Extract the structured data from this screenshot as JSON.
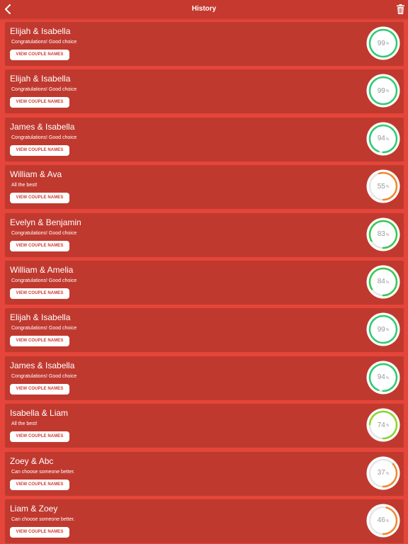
{
  "header": {
    "title": "History"
  },
  "button_label": "VIEW COUPLE NAMES",
  "unit": "%",
  "colors": {
    "background": "#e5453a",
    "card": "#c0392f",
    "high": "#2ecc71",
    "good": "#37c94e",
    "medium": "#8bd62d",
    "low": "#ed8a2d",
    "track": "#e6e6e6"
  },
  "items": [
    {
      "names": "Elijah & Isabella",
      "message": "Congratulations! Good choice",
      "percent": 99,
      "color": "#2ecc71"
    },
    {
      "names": "Elijah & Isabella",
      "message": "Congratulations! Good choice",
      "percent": 99,
      "color": "#2ecc71"
    },
    {
      "names": "James & Isabella",
      "message": "Congratulations! Good choice",
      "percent": 94,
      "color": "#2ecc71"
    },
    {
      "names": "William & Ava",
      "message": "All the best!",
      "percent": 55,
      "color": "#ed8a2d"
    },
    {
      "names": "Evelyn & Benjamin",
      "message": "Congratulations! Good choice",
      "percent": 83,
      "color": "#37c94e"
    },
    {
      "names": "William & Amelia",
      "message": "Congratulations! Good choice",
      "percent": 84,
      "color": "#37c94e"
    },
    {
      "names": "Elijah & Isabella",
      "message": "Congratulations! Good choice",
      "percent": 99,
      "color": "#2ecc71"
    },
    {
      "names": "James & Isabella",
      "message": "Congratulations! Good choice",
      "percent": 94,
      "color": "#2ecc71"
    },
    {
      "names": "Isabella & Liam",
      "message": "All the best!",
      "percent": 74,
      "color": "#8bd62d"
    },
    {
      "names": "Zoey & Abc",
      "message": "Can choose someone better.",
      "percent": 37,
      "color": "#ed8a2d"
    },
    {
      "names": "Liam & Zoey",
      "message": "Can choose someone better.",
      "percent": 46,
      "color": "#ed8a2d"
    }
  ]
}
